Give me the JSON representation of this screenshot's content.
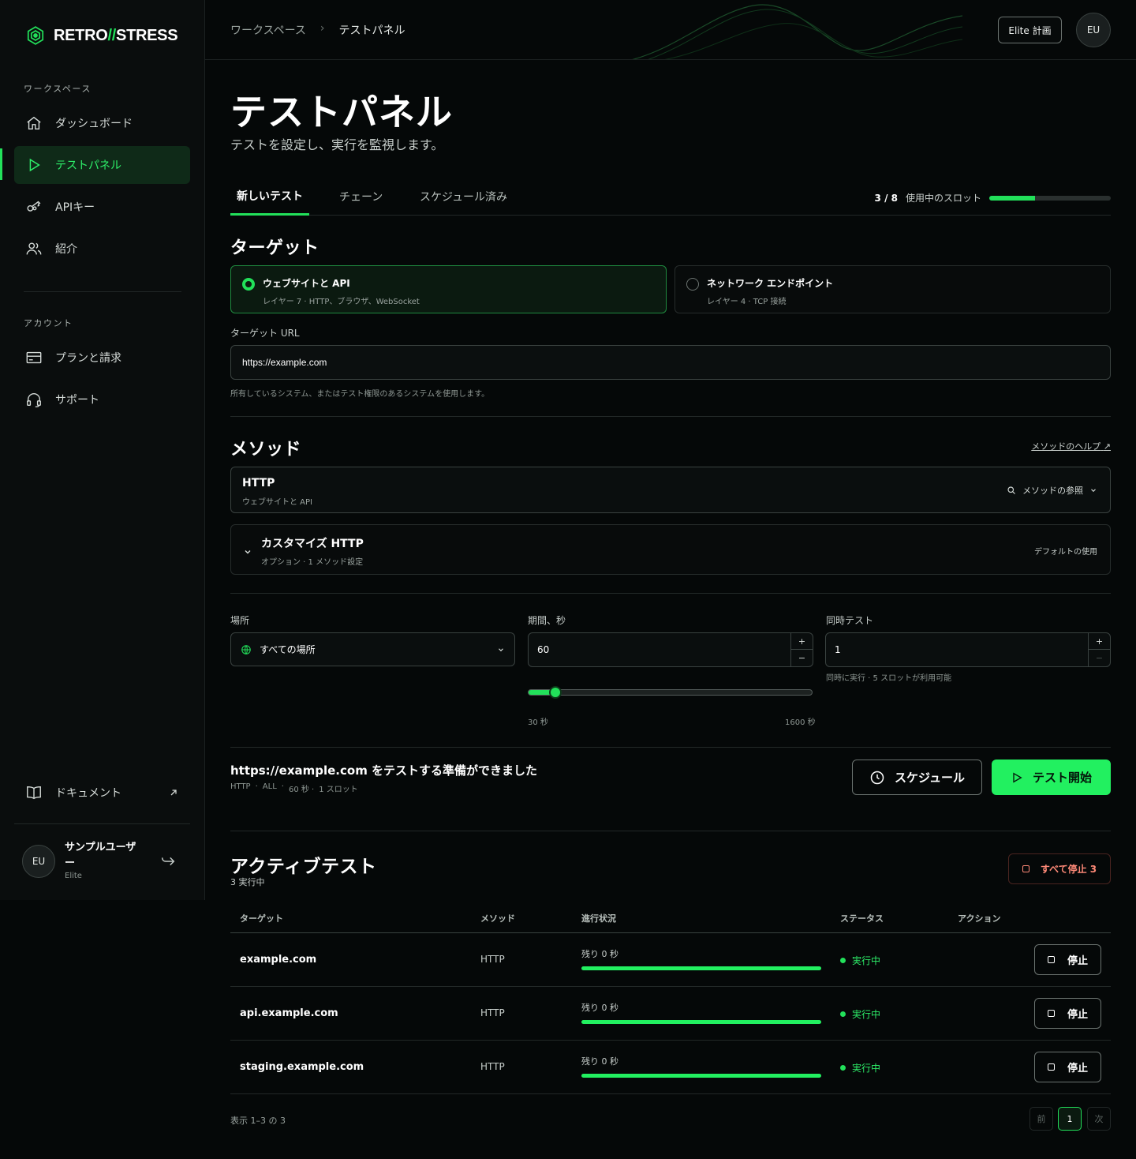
{
  "brand": {
    "name_a": "RETRO",
    "name_sep": "//",
    "name_b": "STRESS",
    "accent": "#22e05a"
  },
  "sidebar": {
    "workspace_label": "ワークスペース",
    "workspace_items": [
      {
        "label": "ダッシュボード",
        "icon": "home-icon"
      },
      {
        "label": "テストパネル",
        "icon": "play-icon",
        "active": true
      },
      {
        "label": "APIキー",
        "icon": "key-icon"
      },
      {
        "label": "紹介",
        "icon": "users-icon"
      }
    ],
    "account_label": "アカウント",
    "account_items": [
      {
        "label": "プランと請求",
        "icon": "card-icon"
      },
      {
        "label": "サポート",
        "icon": "headset-icon"
      }
    ],
    "docs": {
      "label": "ドキュメント",
      "icon": "book-icon"
    },
    "user": {
      "initials": "EU",
      "name": "サンプルユーザー",
      "plan": "Elite"
    }
  },
  "topbar": {
    "breadcrumb": [
      "ワークスペース",
      "テストパネル"
    ],
    "plan_button": "Elite 計画",
    "avatar": "EU"
  },
  "page": {
    "title": "テストパネル",
    "subtitle": "テストを設定し、実行を監視します。",
    "tabs": [
      "新しいテスト",
      "チェーン",
      "スケジュール済み"
    ],
    "slots": {
      "used": "3 / 8",
      "label": "使用中のスロット",
      "fraction": 0.375
    }
  },
  "target": {
    "heading": "ターゲット",
    "options": [
      {
        "title": "ウェブサイトと API",
        "sub": "レイヤー 7 · HTTP、ブラウザ、WebSocket",
        "selected": true
      },
      {
        "title": "ネットワーク エンドポイント",
        "sub": "レイヤー 4 · TCP 接続",
        "selected": false
      }
    ],
    "url_label": "ターゲット URL",
    "url_value": "https://example.com",
    "url_hint": "所有しているシステム、またはテスト権限のあるシステムを使用します。"
  },
  "method": {
    "heading": "メソッド",
    "help_link": "メソッドのヘルプ",
    "selected_title": "HTTP",
    "selected_sub": "ウェブサイトと API",
    "browse_label": "メソッドの参照",
    "custom_title": "カスタマイズ HTTP",
    "custom_sub": "オプション · 1 メソッド設定",
    "custom_right": "デフォルトの使用"
  },
  "params": {
    "location_label": "場所",
    "location_value": "すべての場所",
    "duration_label": "期間、秒",
    "duration_value": "60",
    "duration_min_label": "30 秒",
    "duration_max_label": "1600 秒",
    "duration_min": 30,
    "duration_max": 1600,
    "duration": 60,
    "concurrency_label": "同時テスト",
    "concurrency_value": "1",
    "concurrency_hint": "同時に実行 · 5 スロットが利用可能"
  },
  "ready": {
    "title": "https://example.com をテストする準備ができました",
    "meta": [
      "HTTP",
      "·",
      "ALL",
      "·",
      "60 秒 ·",
      "1 スロット"
    ],
    "schedule_button": "スケジュール",
    "start_button": "テスト開始"
  },
  "active": {
    "heading": "アクティブテスト",
    "count": "3 実行中",
    "stop_all": "すべて停止 3",
    "columns": [
      "ターゲット",
      "メソッド",
      "進行状況",
      "ステータス",
      "アクション"
    ],
    "rows": [
      {
        "target": "example.com",
        "method": "HTTP",
        "remaining": "残り 0 秒",
        "progress": 1.0,
        "status": "実行中",
        "action": "停止"
      },
      {
        "target": "api.example.com",
        "method": "HTTP",
        "remaining": "残り 0 秒",
        "progress": 1.0,
        "status": "実行中",
        "action": "停止"
      },
      {
        "target": "staging.example.com",
        "method": "HTTP",
        "remaining": "残り 0 秒",
        "progress": 1.0,
        "status": "実行中",
        "action": "停止"
      }
    ],
    "showing": "表示 1–3 の 3",
    "pager": {
      "prev": "前",
      "page": "1",
      "next": "次"
    }
  }
}
